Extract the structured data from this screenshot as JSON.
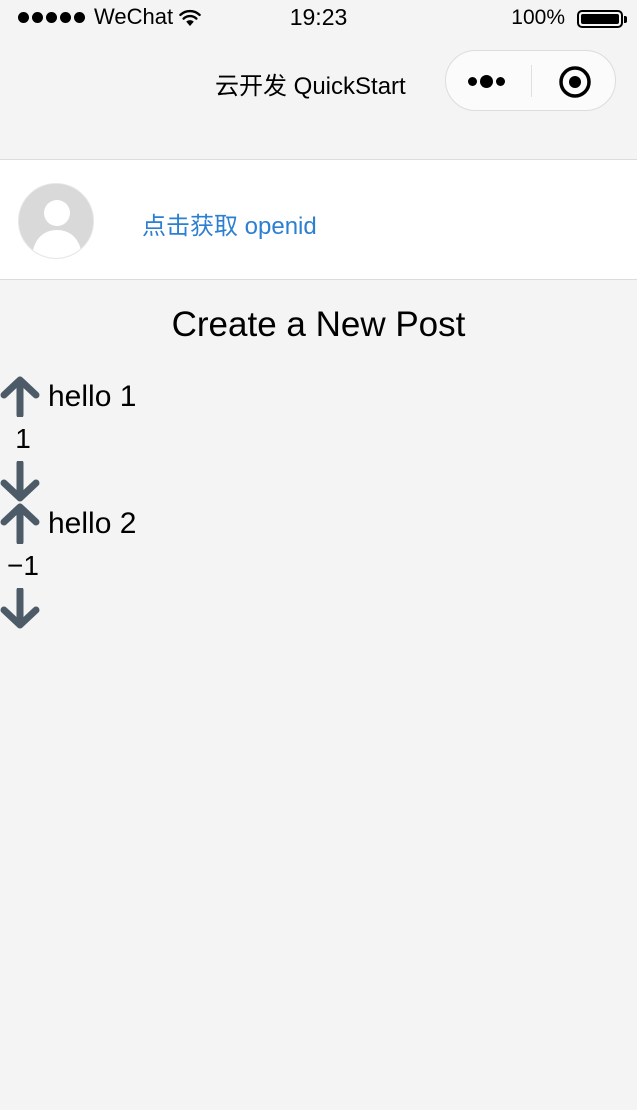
{
  "status_bar": {
    "carrier": "WeChat",
    "time": "19:23",
    "battery": "100%"
  },
  "nav": {
    "title": "云开发 QuickStart",
    "more_icon": "more-dots-icon",
    "close_icon": "close-target-icon"
  },
  "user": {
    "avatar_icon": "default-avatar-icon",
    "openid_link": "点击获取 openid"
  },
  "section": {
    "title": "Create a New Post"
  },
  "posts": [
    {
      "title": "hello 1",
      "votes": "1",
      "upvote_icon": "arrow-up-icon",
      "downvote_icon": "arrow-down-icon"
    },
    {
      "title": "hello 2",
      "votes": "−1",
      "upvote_icon": "arrow-up-icon",
      "downvote_icon": "arrow-down-icon"
    }
  ],
  "colors": {
    "background": "#f4f4f4",
    "link": "#2d7fd1",
    "vote_arrow": "#4c5b67"
  }
}
